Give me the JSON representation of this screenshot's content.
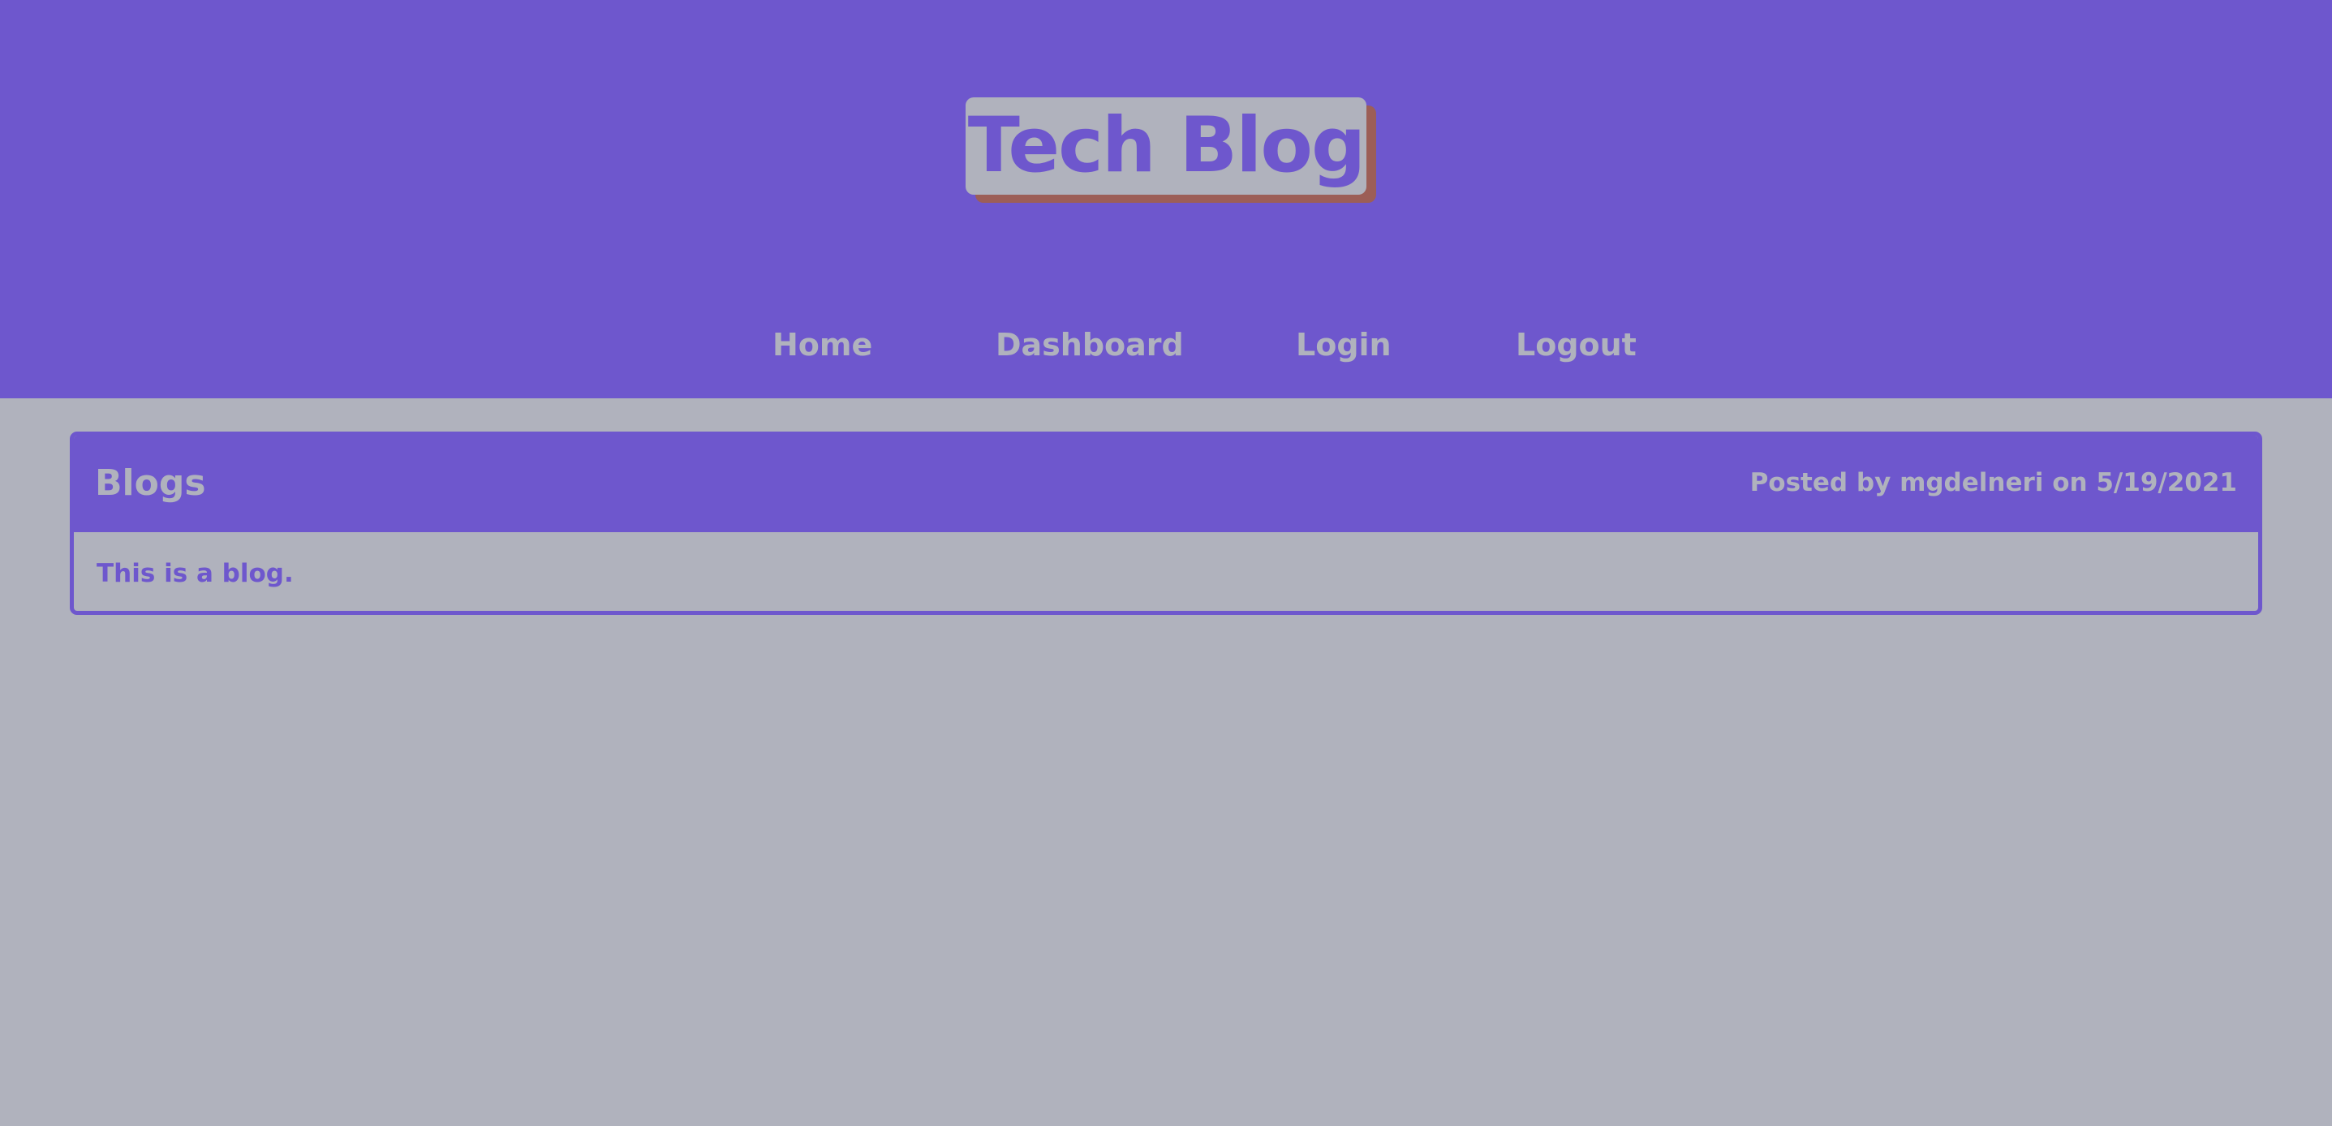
{
  "header": {
    "title": "Tech Blog"
  },
  "nav": {
    "items": [
      {
        "label": "Home"
      },
      {
        "label": "Dashboard"
      },
      {
        "label": "Login"
      },
      {
        "label": "Logout"
      }
    ]
  },
  "main": {
    "section_title": "Blogs",
    "post": {
      "meta": "Posted by mgdelneri on 5/19/2021",
      "content": "This is a blog."
    }
  },
  "colors": {
    "primary": "#6e57cd",
    "background": "#b0b2bd",
    "logo_shadow": "#9c5e57"
  }
}
